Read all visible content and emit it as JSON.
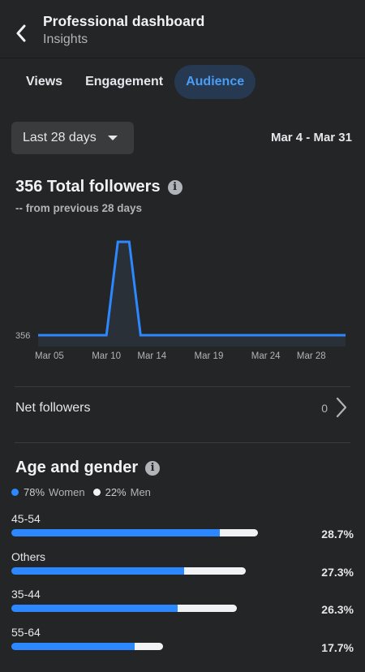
{
  "header": {
    "title": "Professional dashboard",
    "subtitle": "Insights"
  },
  "tabs": [
    {
      "label": "Views",
      "active": false
    },
    {
      "label": "Engagement",
      "active": false
    },
    {
      "label": "Audience",
      "active": true
    }
  ],
  "filter": {
    "range_label": "Last 28 days",
    "date_range": "Mar 4 - Mar 31"
  },
  "followers": {
    "title": "356 Total followers",
    "subtitle": "-- from previous 28 days"
  },
  "chart_data": {
    "type": "area",
    "title": "",
    "xlabel": "",
    "ylabel": "",
    "x": [
      "Mar 04",
      "Mar 05",
      "Mar 06",
      "Mar 07",
      "Mar 08",
      "Mar 09",
      "Mar 10",
      "Mar 11",
      "Mar 12",
      "Mar 13",
      "Mar 14",
      "Mar 15",
      "Mar 16",
      "Mar 17",
      "Mar 18",
      "Mar 19",
      "Mar 20",
      "Mar 21",
      "Mar 22",
      "Mar 23",
      "Mar 24",
      "Mar 25",
      "Mar 26",
      "Mar 27",
      "Mar 28",
      "Mar 29",
      "Mar 30",
      "Mar 31"
    ],
    "values": [
      356,
      356,
      356,
      356,
      356,
      356,
      356,
      357,
      357,
      356,
      356,
      356,
      356,
      356,
      356,
      356,
      356,
      356,
      356,
      356,
      356,
      356,
      356,
      356,
      356,
      356,
      356,
      356
    ],
    "x_tick_labels": [
      "Mar 05",
      "Mar 10",
      "Mar 14",
      "Mar 19",
      "Mar 24",
      "Mar 28"
    ],
    "x_tick_indices": [
      1,
      6,
      10,
      15,
      20,
      24
    ],
    "y_tick_labels": [
      "356"
    ],
    "ylim": [
      356,
      357
    ],
    "color": "#2d88ff",
    "grid": false
  },
  "net_followers": {
    "label": "Net followers",
    "value": "0"
  },
  "age_gender": {
    "title": "Age and gender",
    "legend": [
      {
        "pct": "78%",
        "label": "Women",
        "color": "#2d88ff"
      },
      {
        "pct": "22%",
        "label": "Men",
        "color": "#f0f2f5"
      }
    ],
    "rows": [
      {
        "label": "45-54",
        "pct": "28.7%",
        "women": 0.846,
        "men": 0.154,
        "scale": 0.724
      },
      {
        "label": "Others",
        "pct": "27.3%",
        "women": 0.737,
        "men": 0.263,
        "scale": 0.688
      },
      {
        "label": "35-44",
        "pct": "26.3%",
        "women": 0.737,
        "men": 0.263,
        "scale": 0.663
      },
      {
        "label": "55-64",
        "pct": "17.7%",
        "women": 0.814,
        "men": 0.186,
        "scale": 0.446
      }
    ]
  },
  "colors": {
    "background": "#242526",
    "accent": "#2d88ff",
    "active_tab_bg": "#263951"
  }
}
